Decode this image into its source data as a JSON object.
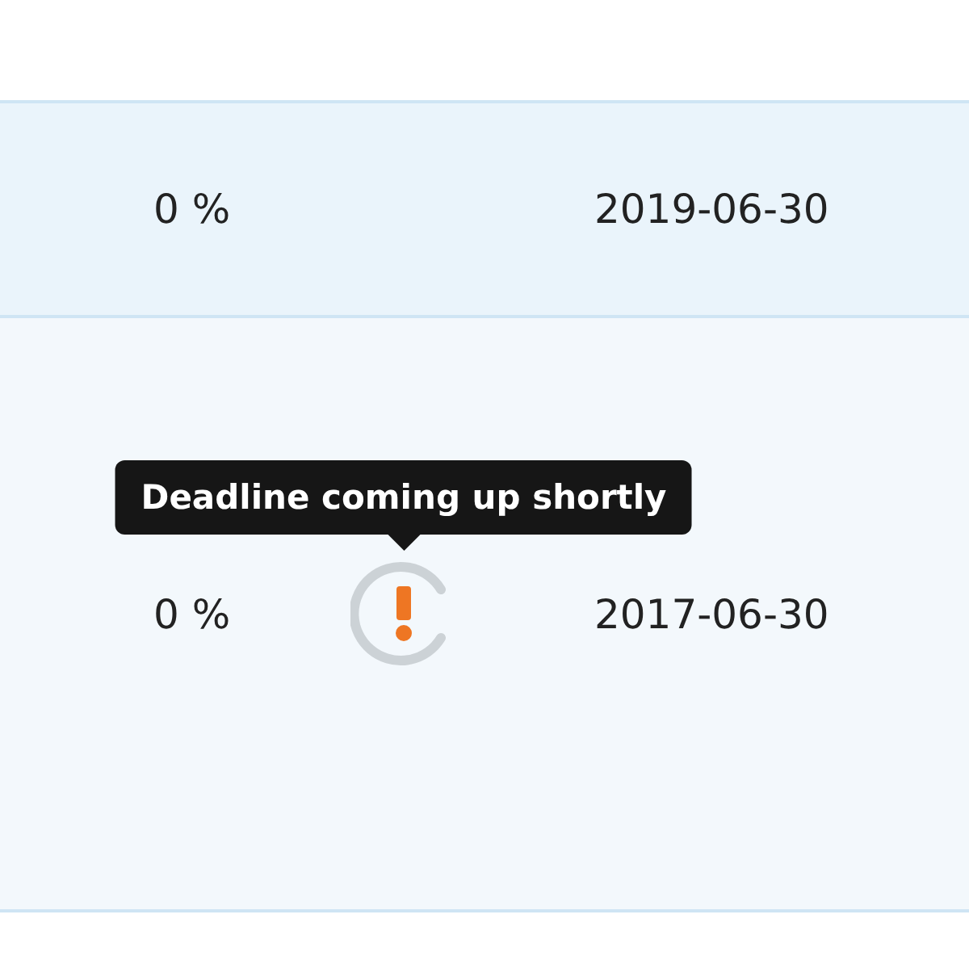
{
  "rows": [
    {
      "progress": "0 %",
      "status": {
        "kind": "none"
      },
      "date": "2019-06-30"
    },
    {
      "progress": "0 %",
      "status": {
        "kind": "deadline-warning",
        "tooltip": "Deadline coming up shortly"
      },
      "date": "2017-06-30"
    }
  ]
}
